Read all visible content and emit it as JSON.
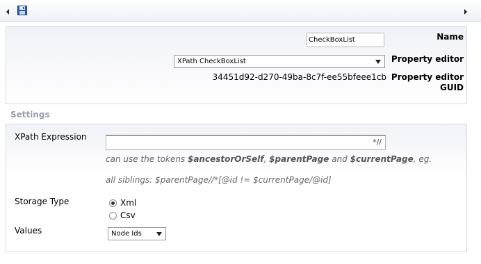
{
  "toolbar": {
    "save_icon": "floppy-disk-icon"
  },
  "panel": {
    "name_label": "Name",
    "name_value": "CheckBoxList",
    "property_editor_label": "Property editor",
    "property_editor_value": "XPath CheckBoxList",
    "property_editor_guid_label": "Property editor GUID",
    "guid_value": "34451d92-d270-49ba-8c7f-ee55bfeee1cb"
  },
  "settings": {
    "heading": "Settings",
    "xpath_label": "XPath Expression",
    "xpath_value": "*//",
    "help_pre": "can use the tokens ",
    "token1": "$ancestorOrSelf",
    "sep1": ", ",
    "token2": "$parentPage",
    "and": " and ",
    "token3": "$currentPage",
    "help_post": ", eg.",
    "example": "all siblings: $parentPage//*[@id != $currentPage/@id]",
    "storage_label": "Storage Type",
    "storage_options": [
      "Xml",
      "Csv"
    ],
    "storage_selected": "Xml",
    "values_label": "Values",
    "values_value": "Node Ids"
  }
}
